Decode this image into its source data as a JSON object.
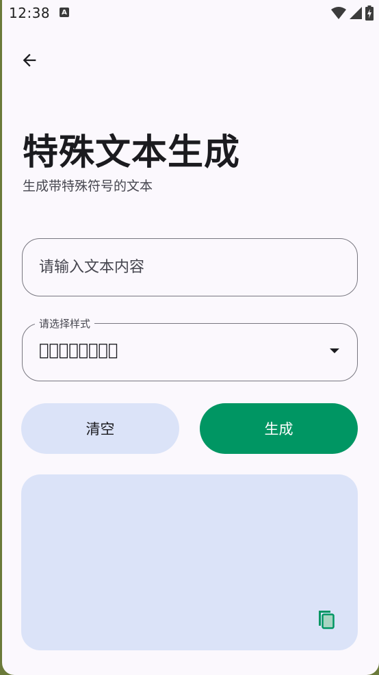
{
  "status_bar": {
    "time": "12:38",
    "notification_badge": "A",
    "icons": [
      "wifi-icon",
      "signal-icon",
      "battery-charging-icon"
    ]
  },
  "header": {
    "back_icon": "arrow-left-icon",
    "title": "特殊文本生成",
    "subtitle": "生成带特殊符号的文本"
  },
  "form": {
    "text_input": {
      "value": "",
      "placeholder": "请输入文本内容"
    },
    "style_select": {
      "label": "请选择样式",
      "selected_value": "测⃠试⃠测⃠试⃠"
    }
  },
  "actions": {
    "clear_label": "清空",
    "generate_label": "生成"
  },
  "result": {
    "text": "",
    "copy_icon": "copy-icon"
  },
  "colors": {
    "background": "#fbf8fd",
    "primary": "#009663",
    "secondary_container": "#dbe3f8",
    "outline": "#77767f"
  }
}
